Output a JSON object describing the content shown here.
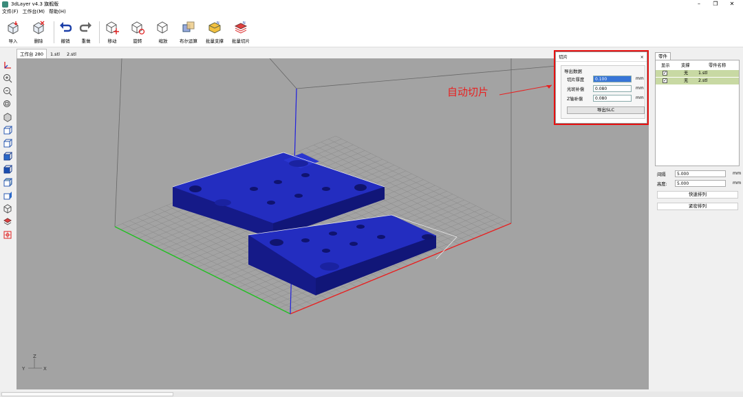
{
  "window": {
    "title": "3dLayer v4.3 旗舰版",
    "minimize": "–",
    "maximize": "❐",
    "close": "✕"
  },
  "menu": [
    "文件(F)",
    "工作台(M)",
    "帮助(H)"
  ],
  "toolbar": {
    "import": "导入",
    "delete": "删除",
    "undo": "撤销",
    "redo": "重做",
    "move": "移动",
    "rotate": "旋转",
    "scale": "缩放",
    "boolean": "布尔运算",
    "batch_support": "批量支撑",
    "batch_slice": "批量切片"
  },
  "tabs": [
    "工作台 280",
    "1.stl",
    "2.stl"
  ],
  "slice_dialog": {
    "title": "切片",
    "close": "×",
    "group": "导出数据",
    "fields": [
      {
        "label": "切片厚度",
        "value": "0.100",
        "unit": "mm"
      },
      {
        "label": "光斑补偿",
        "value": "0.080",
        "unit": "mm"
      },
      {
        "label": "Z轴补偿",
        "value": "0.080",
        "unit": "mm"
      }
    ],
    "export_button": "导出SLC"
  },
  "annotation": "自动切片",
  "parts_panel": {
    "tab": "零件",
    "headers": [
      "显示",
      "支撑",
      "零件名称"
    ],
    "rows": [
      {
        "checked": "✓",
        "support": "无",
        "name": "1.stl"
      },
      {
        "checked": "✓",
        "support": "无",
        "name": "2.stl"
      }
    ]
  },
  "arrange": {
    "spacing_label": "间隔",
    "spacing_value": "5.000",
    "height_label": "高度:",
    "height_value": "5.000",
    "unit": "mm",
    "quick_button": "快速排列",
    "tight_button": "紧密排列"
  },
  "axis_labels": {
    "x": "X",
    "y": "Y",
    "z": "Z"
  },
  "colors": {
    "model": "#1c22a8",
    "x_axis": "#e82020",
    "y_axis": "#20c020",
    "z_axis": "#2020e0",
    "highlight": "#e81010",
    "selected_row": "#c8d9a3"
  }
}
